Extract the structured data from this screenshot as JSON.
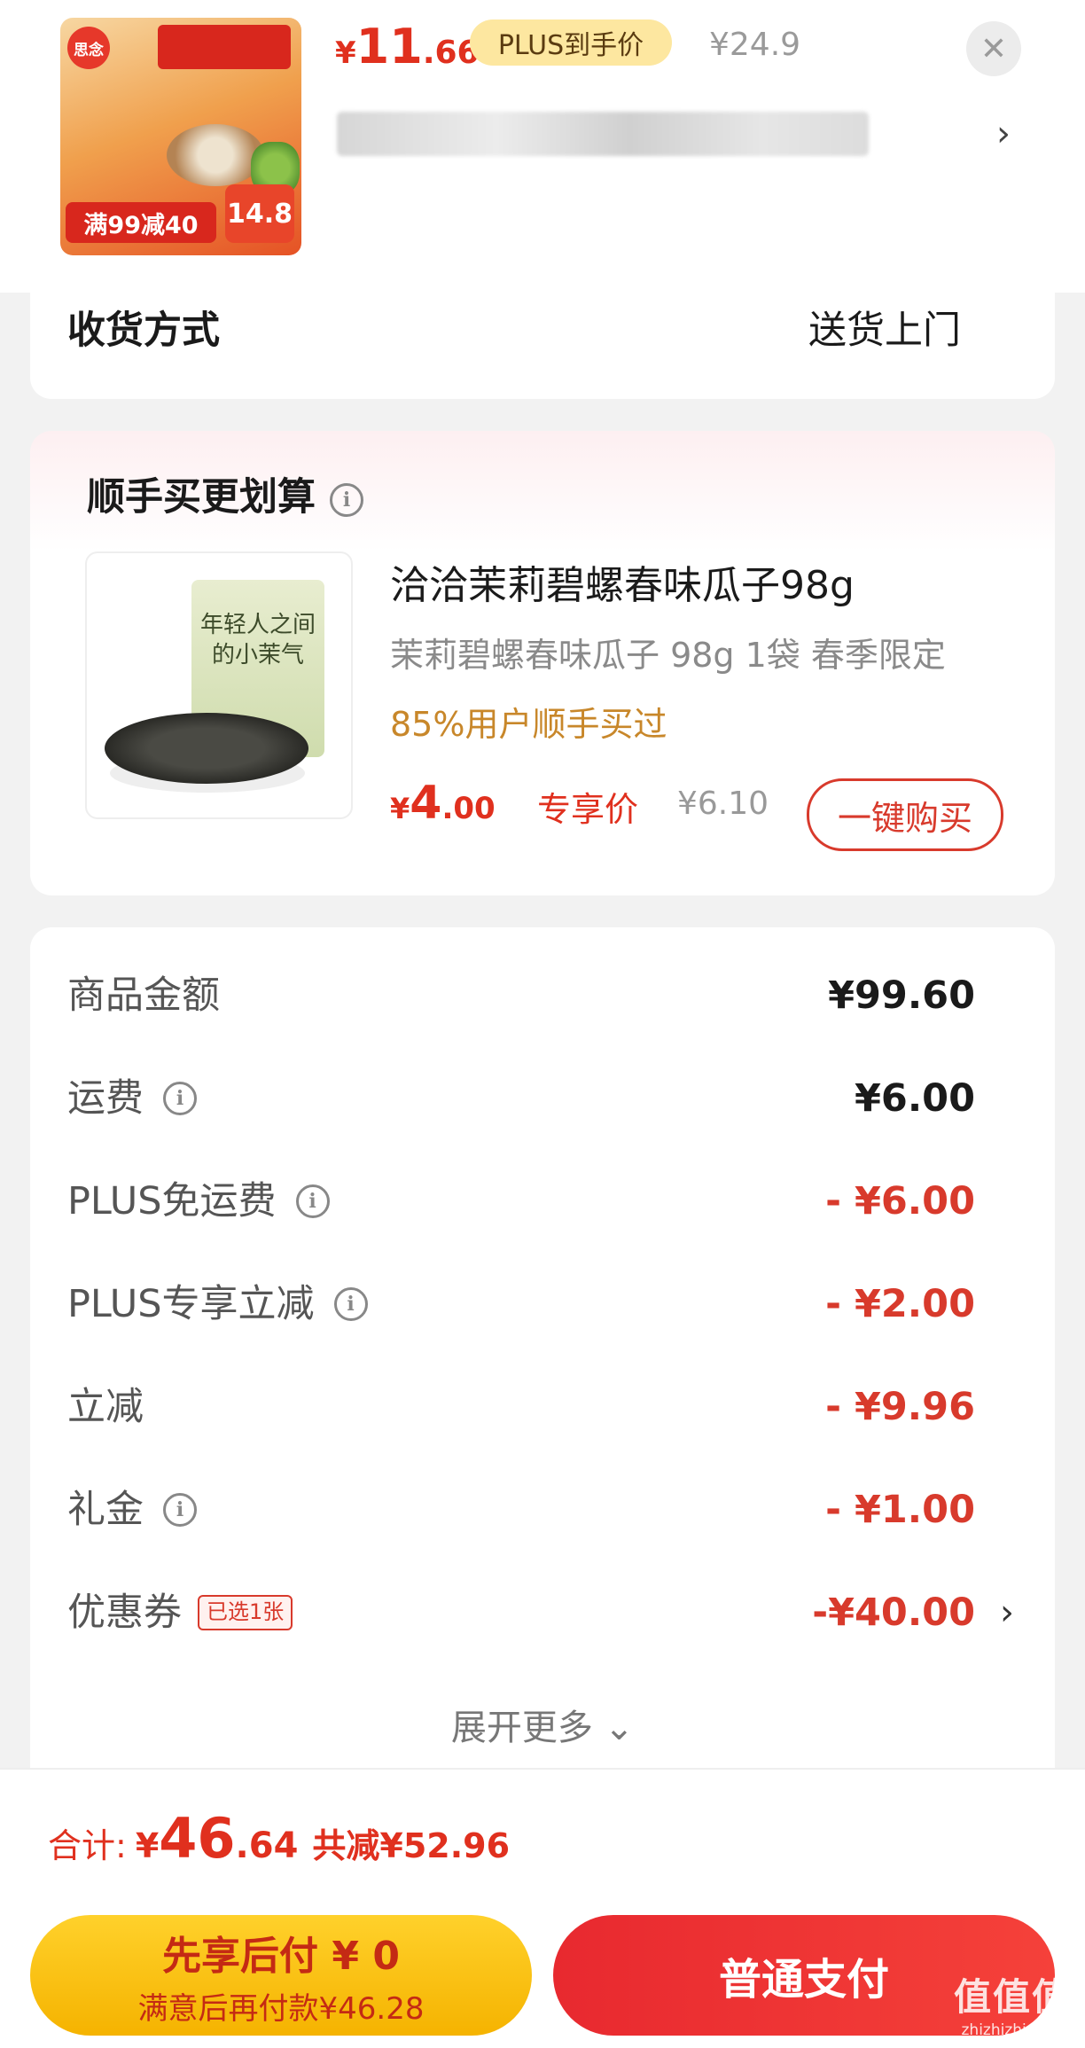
{
  "top_item": {
    "price_yen": "¥",
    "price_int": "11",
    "price_dec": ".66",
    "plus_label": "PLUS到手价",
    "original_price": "¥24.9",
    "thumb_brand": "思念",
    "thumb_promo": "满99减40",
    "thumb_price": "14.8"
  },
  "delivery": {
    "label": "收货方式",
    "value": "送货上门"
  },
  "upsell": {
    "heading": "顺手买更划算",
    "bag_text": "年轻人之间的小茉气",
    "product": {
      "title": "洽洽茉莉碧螺春味瓜子98g",
      "spec": "茉莉碧螺春味瓜子 98g 1袋 春季限定",
      "social_proof": "85%用户顺手买过",
      "price_yen": "¥",
      "price_int": "4",
      "price_dec": ".00",
      "price_tag": "专享价",
      "original_price": "¥6.10",
      "buy_button": "一键购买"
    }
  },
  "fees": {
    "rows": [
      {
        "label": "商品金额",
        "amount": "¥99.60"
      },
      {
        "label": "运费",
        "amount": "¥6.00"
      },
      {
        "label": "PLUS免运费",
        "amount": "- ¥6.00"
      },
      {
        "label": "PLUS专享立减",
        "amount": "- ¥2.00"
      },
      {
        "label": "立减",
        "amount": "- ¥9.96"
      },
      {
        "label": "礼金",
        "amount": "- ¥1.00"
      },
      {
        "label": "优惠券",
        "chip": "已选1张",
        "amount": "-¥40.00"
      }
    ],
    "expand_label": "展开更多"
  },
  "total": {
    "label": "合计:",
    "yen": "¥",
    "int": "46",
    "dec": ".64",
    "saved": "共减¥52.96"
  },
  "actions": {
    "pay_later_title": "先享后付 ¥ 0",
    "pay_later_sub": "满意后再付款¥46.28",
    "pay_normal": "普通支付"
  },
  "watermark": {
    "line1": "值值值",
    "line2": "zhizhizhi.com"
  },
  "colors": {
    "accent_red": "#e0301e",
    "plus_chip": "#fde7a0",
    "pay_later_yellow": "#ffd12b",
    "social_proof_gold": "#c8872a"
  }
}
